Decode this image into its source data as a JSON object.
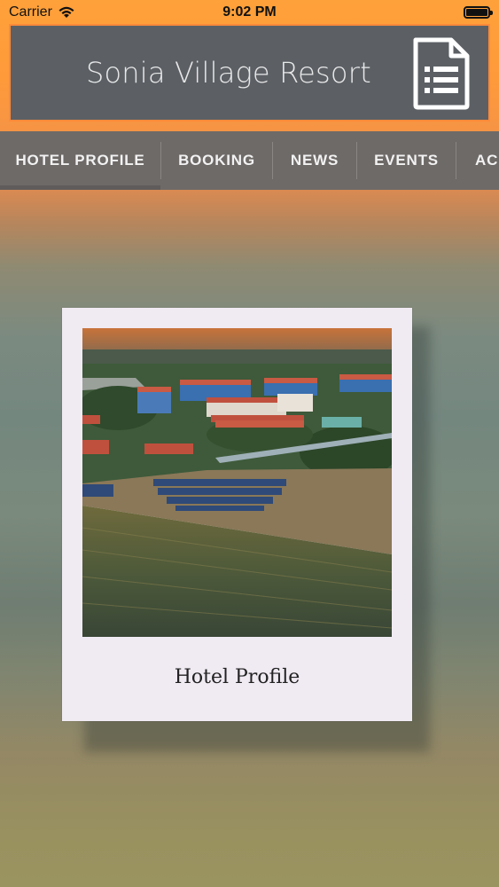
{
  "status_bar": {
    "carrier": "Carrier",
    "time": "9:02 PM"
  },
  "header": {
    "title": "Sonia Village Resort",
    "menu_icon": "document-list-icon"
  },
  "nav": {
    "tabs": [
      {
        "label": "HOTEL PROFILE",
        "active": true
      },
      {
        "label": "BOOKING",
        "active": false
      },
      {
        "label": "NEWS",
        "active": false
      },
      {
        "label": "EVENTS",
        "active": false
      },
      {
        "label": "AC",
        "active": false
      }
    ]
  },
  "card": {
    "caption": "Hotel Profile",
    "image": "aerial-resort-beach-photo"
  },
  "colors": {
    "accent": "#FF9A3A",
    "header_box": "#5C6065",
    "nav_bg": "#6E6A68"
  }
}
